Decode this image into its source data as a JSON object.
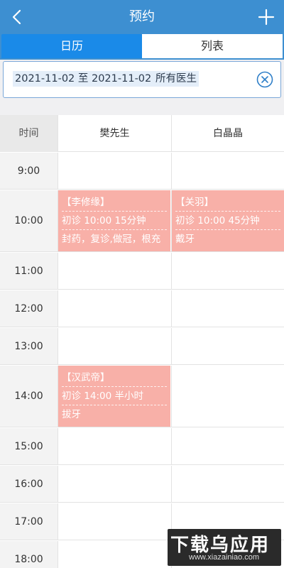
{
  "header": {
    "title": "预约",
    "back_icon": "chevron-left-icon",
    "add_icon": "plus-icon"
  },
  "tabs": [
    {
      "label": "日历",
      "active": true
    },
    {
      "label": "列表",
      "active": false
    }
  ],
  "filter": {
    "date_range": "2021-11-02 至 2021-11-02",
    "doctor": "所有医生",
    "clear_icon": "clear-circle-icon"
  },
  "grid": {
    "time_header": "时间",
    "doctors": [
      "樊先生",
      "白晶晶"
    ],
    "slots": [
      "9:00",
      "10:00",
      "11:00",
      "12:00",
      "13:00",
      "14:00",
      "15:00",
      "16:00",
      "17:00",
      "18:00"
    ]
  },
  "appointments": [
    {
      "patient": "【李修缘】",
      "info": "初诊 10:00 15分钟",
      "treatment": "封药，复诊,做冠，根充"
    },
    {
      "patient": "【关羽】",
      "info": "初诊 10:00 45分钟",
      "treatment": "戴牙"
    },
    {
      "patient": "【汉武帝】",
      "info": "初诊 14:00 半小时",
      "treatment": "拔牙"
    }
  ],
  "watermark": {
    "main": "下载乌应用",
    "sub": "www.xiazainiao.com"
  },
  "colors": {
    "header": "#3d8fd1",
    "active_tab": "#1a8ae8",
    "appointment": "#f8b0a8"
  }
}
